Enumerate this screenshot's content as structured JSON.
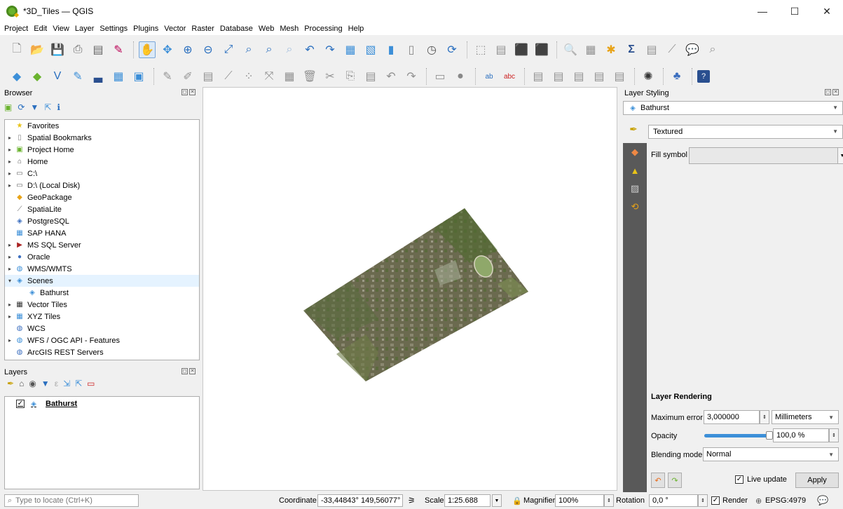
{
  "window": {
    "title": "*3D_Tiles — QGIS",
    "minimize": "—",
    "maximize": "☐",
    "close": "✕"
  },
  "menu": [
    "Project",
    "Edit",
    "View",
    "Layer",
    "Settings",
    "Plugins",
    "Vector",
    "Raster",
    "Database",
    "Web",
    "Mesh",
    "Processing",
    "Help"
  ],
  "browser": {
    "title": "Browser",
    "items": [
      {
        "label": "Favorites",
        "icon": "star-icon",
        "arrow": "",
        "indent": 0
      },
      {
        "label": "Spatial Bookmarks",
        "icon": "bookmark-icon",
        "arrow": "▸",
        "indent": 0
      },
      {
        "label": "Project Home",
        "icon": "project-home-icon",
        "arrow": "▸",
        "indent": 0
      },
      {
        "label": "Home",
        "icon": "home-folder-icon",
        "arrow": "▸",
        "indent": 0
      },
      {
        "label": "C:\\",
        "icon": "drive-icon",
        "arrow": "▸",
        "indent": 0
      },
      {
        "label": "D:\\ (Local Disk)",
        "icon": "drive-icon",
        "arrow": "▸",
        "indent": 0
      },
      {
        "label": "GeoPackage",
        "icon": "geopackage-icon",
        "arrow": "",
        "indent": 0
      },
      {
        "label": "SpatiaLite",
        "icon": "spatialite-icon",
        "arrow": "",
        "indent": 0
      },
      {
        "label": "PostgreSQL",
        "icon": "postgresql-icon",
        "arrow": "",
        "indent": 0
      },
      {
        "label": "SAP HANA",
        "icon": "sap-hana-icon",
        "arrow": "",
        "indent": 0
      },
      {
        "label": "MS SQL Server",
        "icon": "mssql-icon",
        "arrow": "▸",
        "indent": 0
      },
      {
        "label": "Oracle",
        "icon": "oracle-icon",
        "arrow": "▸",
        "indent": 0
      },
      {
        "label": "WMS/WMTS",
        "icon": "wms-icon",
        "arrow": "▸",
        "indent": 0
      },
      {
        "label": "Scenes",
        "icon": "scenes-icon",
        "arrow": "▾",
        "indent": 0
      },
      {
        "label": "Bathurst",
        "icon": "tiles-icon",
        "arrow": "",
        "indent": 1
      },
      {
        "label": "Vector Tiles",
        "icon": "vector-tiles-icon",
        "arrow": "▸",
        "indent": 0
      },
      {
        "label": "XYZ Tiles",
        "icon": "xyz-tiles-icon",
        "arrow": "▸",
        "indent": 0
      },
      {
        "label": "WCS",
        "icon": "wcs-icon",
        "arrow": "",
        "indent": 0
      },
      {
        "label": "WFS / OGC API - Features",
        "icon": "wfs-icon",
        "arrow": "▸",
        "indent": 0
      },
      {
        "label": "ArcGIS REST Servers",
        "icon": "arcgis-icon",
        "arrow": "",
        "indent": 0
      }
    ]
  },
  "layers": {
    "title": "Layers",
    "items": [
      {
        "label": "Bathurst",
        "checked": "✓"
      }
    ]
  },
  "styling": {
    "title": "Layer Styling",
    "layer": "Bathurst",
    "renderer": "Textured",
    "fill_symbol_label": "Fill symbol",
    "rendering_title": "Layer Rendering",
    "max_error_label": "Maximum error",
    "max_error_value": "3,000000",
    "max_error_unit": "Millimeters",
    "opacity_label": "Opacity",
    "opacity_value": "100,0 %",
    "opacity_level": 1.0,
    "blending_label": "Blending mode",
    "blending_value": "Normal",
    "live_update_label": "Live update",
    "live_update_checked": "✓",
    "apply_label": "Apply"
  },
  "status": {
    "locate_placeholder": "Type to locate (Ctrl+K)",
    "coordinate_label": "Coordinate",
    "coordinate_value": "-33,44843° 149,56077°",
    "scale_label": "Scale",
    "scale_value": "1:25.688",
    "magnifier_label": "Magnifier",
    "magnifier_value": "100%",
    "rotation_label": "Rotation",
    "rotation_value": "0,0 °",
    "render_label": "Render",
    "render_checked": "✓",
    "crs": "EPSG:4979"
  },
  "colors": {
    "accent": "#3c8fd8",
    "panel_dark": "#595959"
  }
}
